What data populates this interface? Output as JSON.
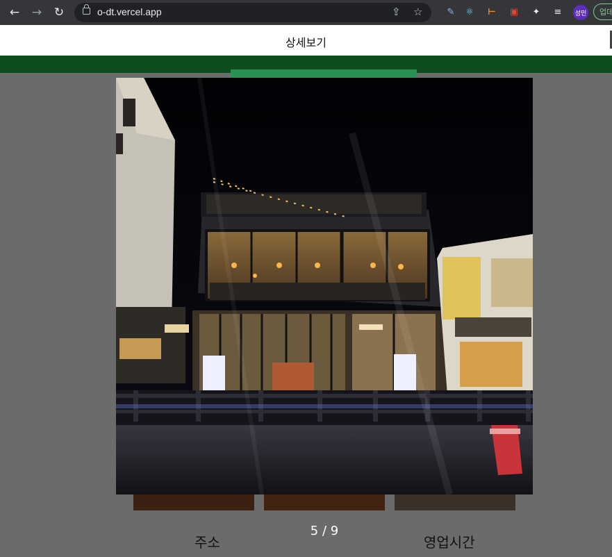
{
  "browser": {
    "url": "o-dt.vercel.app",
    "profile_label": "성민",
    "update_label": "업데"
  },
  "modal": {
    "title": "상세보기",
    "counter": "5 / 9"
  },
  "background": {
    "address_label": "주소",
    "hours_label": "영업시간"
  }
}
